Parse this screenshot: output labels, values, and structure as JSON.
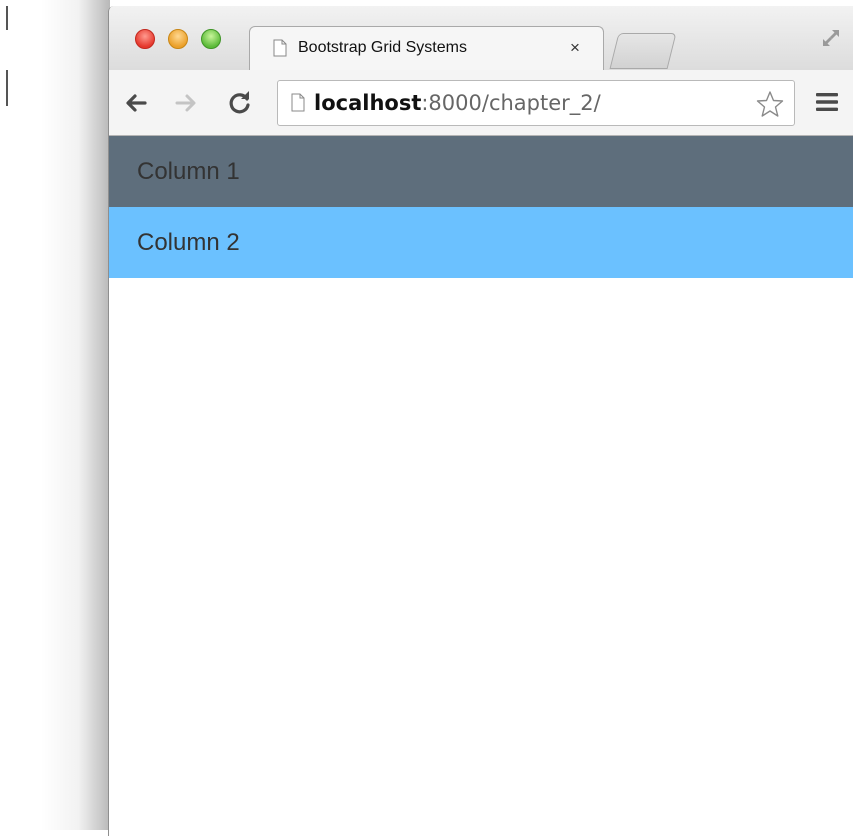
{
  "tab": {
    "title": "Bootstrap Grid Systems",
    "close_glyph": "×"
  },
  "address_bar": {
    "host": "localhost",
    "rest": ":8000/chapter_2/"
  },
  "columns": [
    {
      "label": "Column 1",
      "color": "#5e6e7c"
    },
    {
      "label": "Column 2",
      "color": "#6bc1ff"
    }
  ],
  "icons": {
    "back": "back-arrow-icon",
    "forward": "forward-arrow-icon",
    "reload": "reload-icon",
    "star": "star-icon",
    "menu": "menu-icon",
    "fullscreen": "fullscreen-icon",
    "page": "page-icon"
  }
}
